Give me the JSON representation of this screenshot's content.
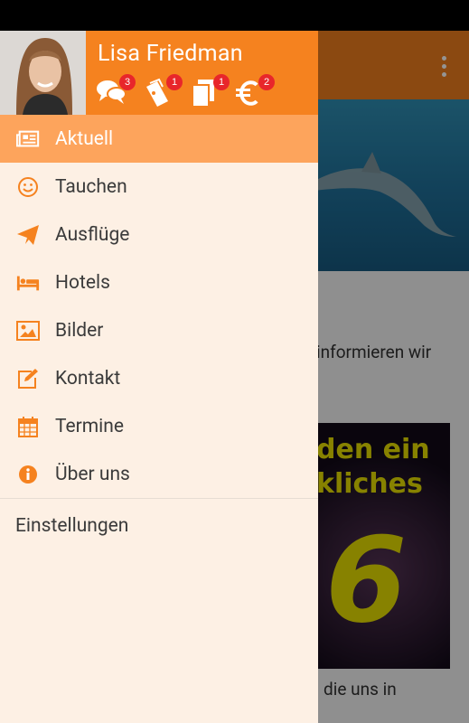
{
  "user": {
    "name": "Lisa Friedman"
  },
  "header_icons": [
    {
      "icon": "chat-bubbles-icon",
      "badge": "3"
    },
    {
      "icon": "tickets-icon",
      "badge": "1"
    },
    {
      "icon": "documents-icon",
      "badge": "1"
    },
    {
      "icon": "euro-icon",
      "badge": "2"
    }
  ],
  "menu": [
    {
      "label": "Aktuell",
      "icon": "newspaper-icon",
      "active": true
    },
    {
      "label": "Tauchen",
      "icon": "smiley-icon"
    },
    {
      "label": "Ausflüge",
      "icon": "paper-plane-icon"
    },
    {
      "label": "Hotels",
      "icon": "bed-icon"
    },
    {
      "label": "Bilder",
      "icon": "image-icon"
    },
    {
      "label": "Kontakt",
      "icon": "edit-icon"
    },
    {
      "label": "Termine",
      "icon": "calendar-icon"
    },
    {
      "label": "Über uns",
      "icon": "info-icon"
    }
  ],
  "settings_label": "Einstellungen",
  "background": {
    "text1": "informieren wir",
    "text2": ".",
    "text3": "die uns in",
    "poster_line1": "den ein",
    "poster_line2": "kliches",
    "poster_number": "6"
  },
  "colors": {
    "accent": "#f5821f",
    "active_item": "#fda45c",
    "drawer_bg": "#fdf0e4",
    "badge": "#e8262b"
  }
}
